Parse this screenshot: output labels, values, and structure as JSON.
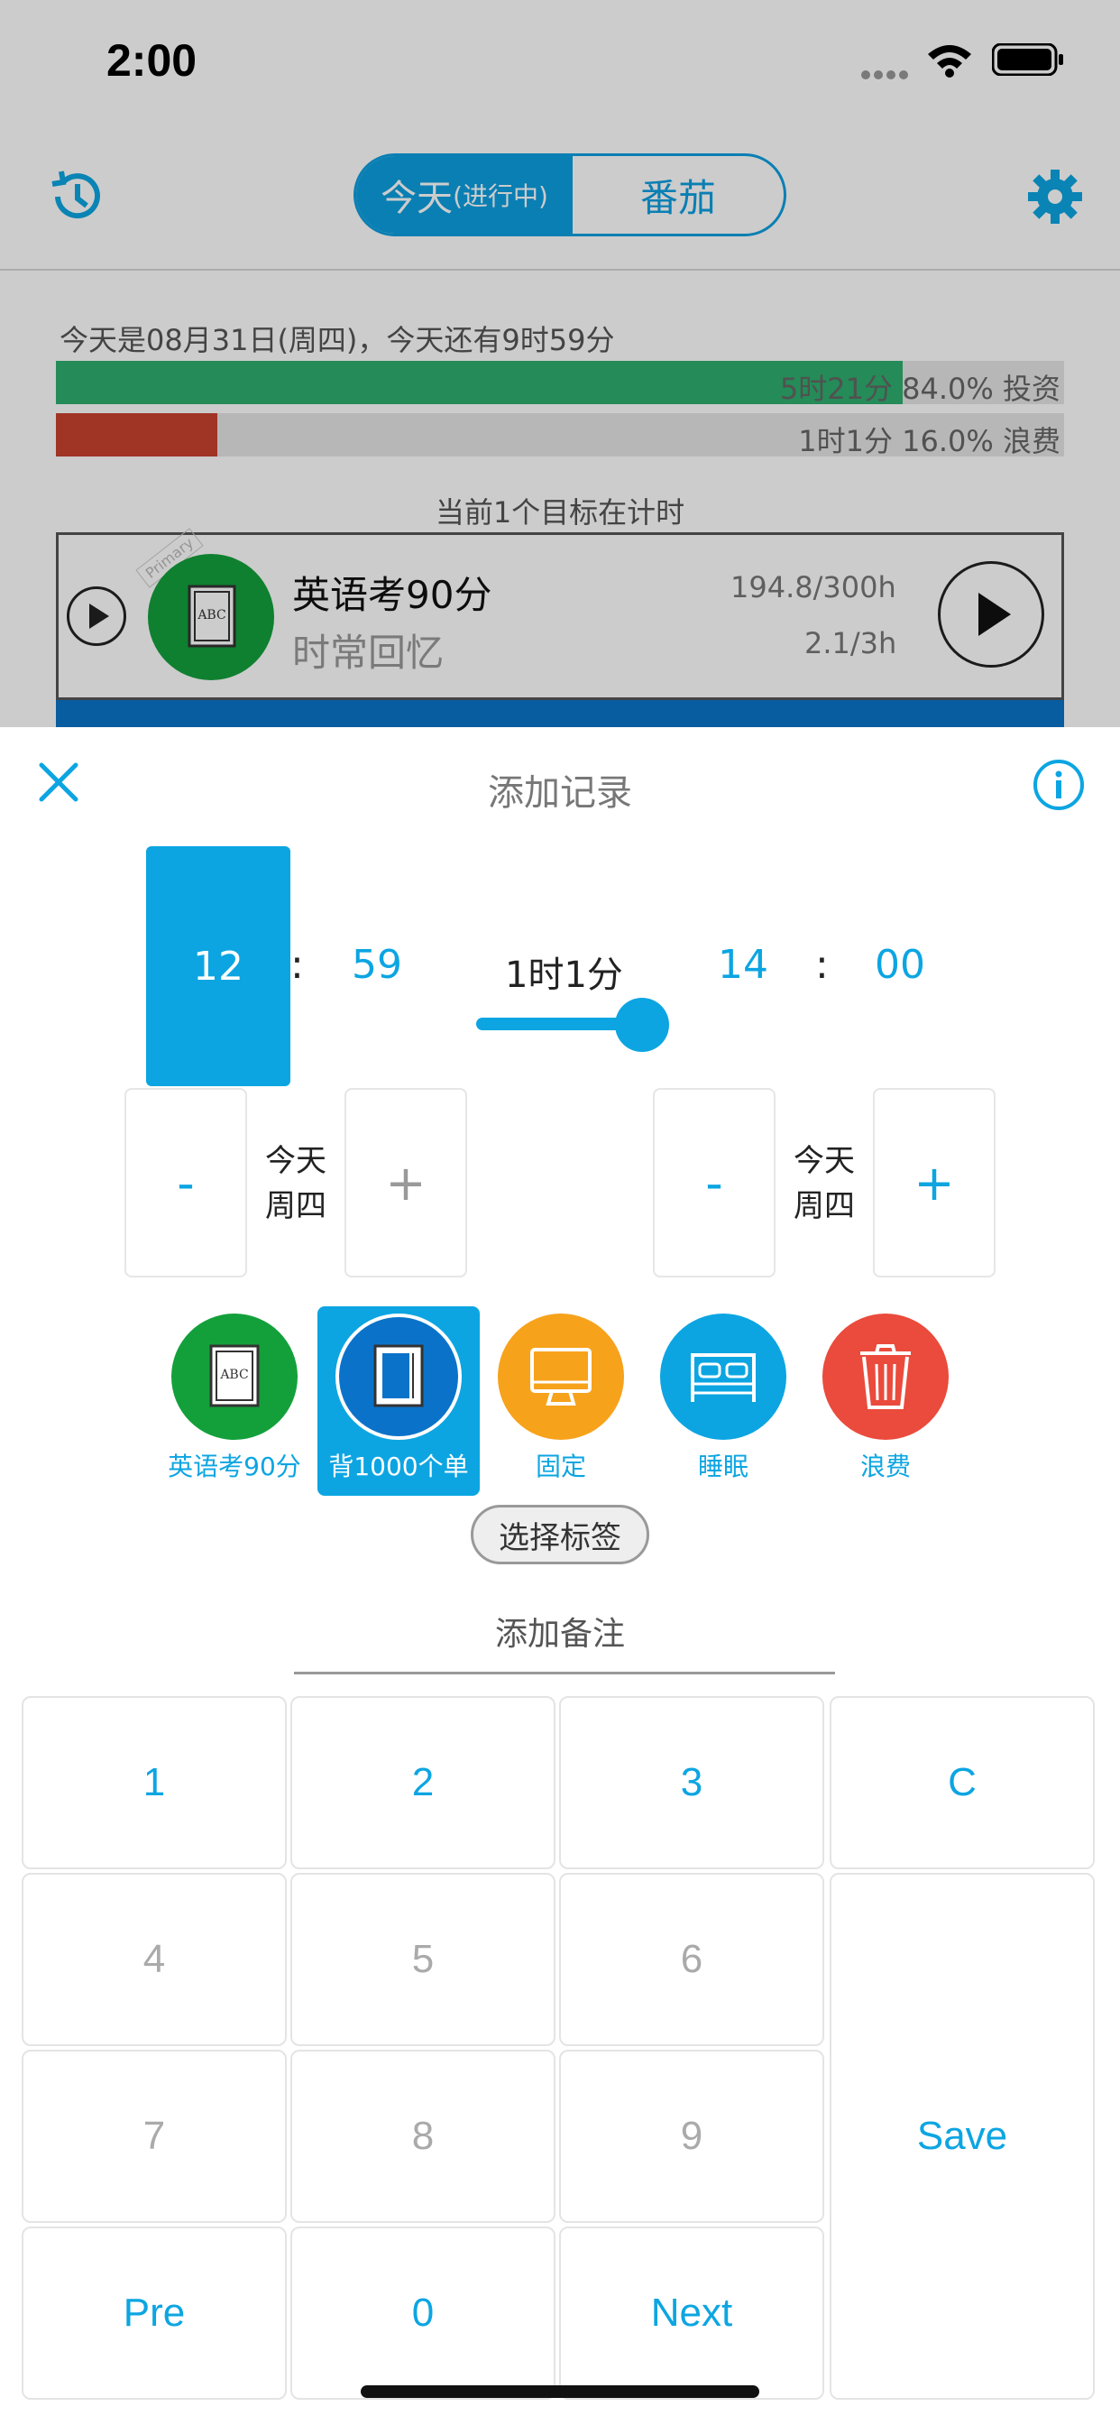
{
  "status": {
    "time": "2:00"
  },
  "nav": {
    "tab_today": "今天",
    "tab_today_suffix": "(进行中)",
    "tab_tomato": "番茄"
  },
  "summary": {
    "info": "今天是08月31日(周四)，今天还有9时59分",
    "invest_label": "5时21分 84.0% 投资",
    "invest_fraction": 0.84,
    "waste_label": "1时1分 16.0% 浪费",
    "waste_fraction": 0.16,
    "current_goal_text": "当前1个目标在计时"
  },
  "goal": {
    "tag": "Primary",
    "title": "英语考90分",
    "subtitle": "时常回忆",
    "hours_total": "194.8/300h",
    "hours_today": "2.1/3h"
  },
  "sheet": {
    "title": "添加记录",
    "start_hour": "12",
    "start_minute": "59",
    "duration": "1时1分",
    "end_hour": "14",
    "end_minute": "00",
    "colon": ":",
    "start_day": "今天",
    "start_weekday": "周四",
    "end_day": "今天",
    "end_weekday": "周四",
    "minus": "-",
    "plus": "+",
    "slider_fraction": 0.85
  },
  "categories": [
    {
      "label": "英语考90分",
      "color": "#13a03b",
      "icon": "book-icon"
    },
    {
      "label": "背1000个单",
      "color": "#0a73c9",
      "icon": "book-icon",
      "selected": true
    },
    {
      "label": "固定",
      "color": "#f7a21b",
      "icon": "monitor-icon"
    },
    {
      "label": "睡眠",
      "color": "#0ca5e2",
      "icon": "bed-icon"
    },
    {
      "label": "浪费",
      "color": "#ea4b3c",
      "icon": "trash-icon"
    }
  ],
  "tags_button": "选择标签",
  "note_label": "添加备注",
  "keypad": {
    "k1": "1",
    "k2": "2",
    "k3": "3",
    "clear": "C",
    "k4": "4",
    "k5": "5",
    "k6": "6",
    "k7": "7",
    "k8": "8",
    "k9": "9",
    "save": "Save",
    "pre": "Pre",
    "k0": "0",
    "next": "Next"
  },
  "colors": {
    "accent": "#0ca5e2",
    "invest": "#2fae6e",
    "waste": "#c8412f"
  }
}
